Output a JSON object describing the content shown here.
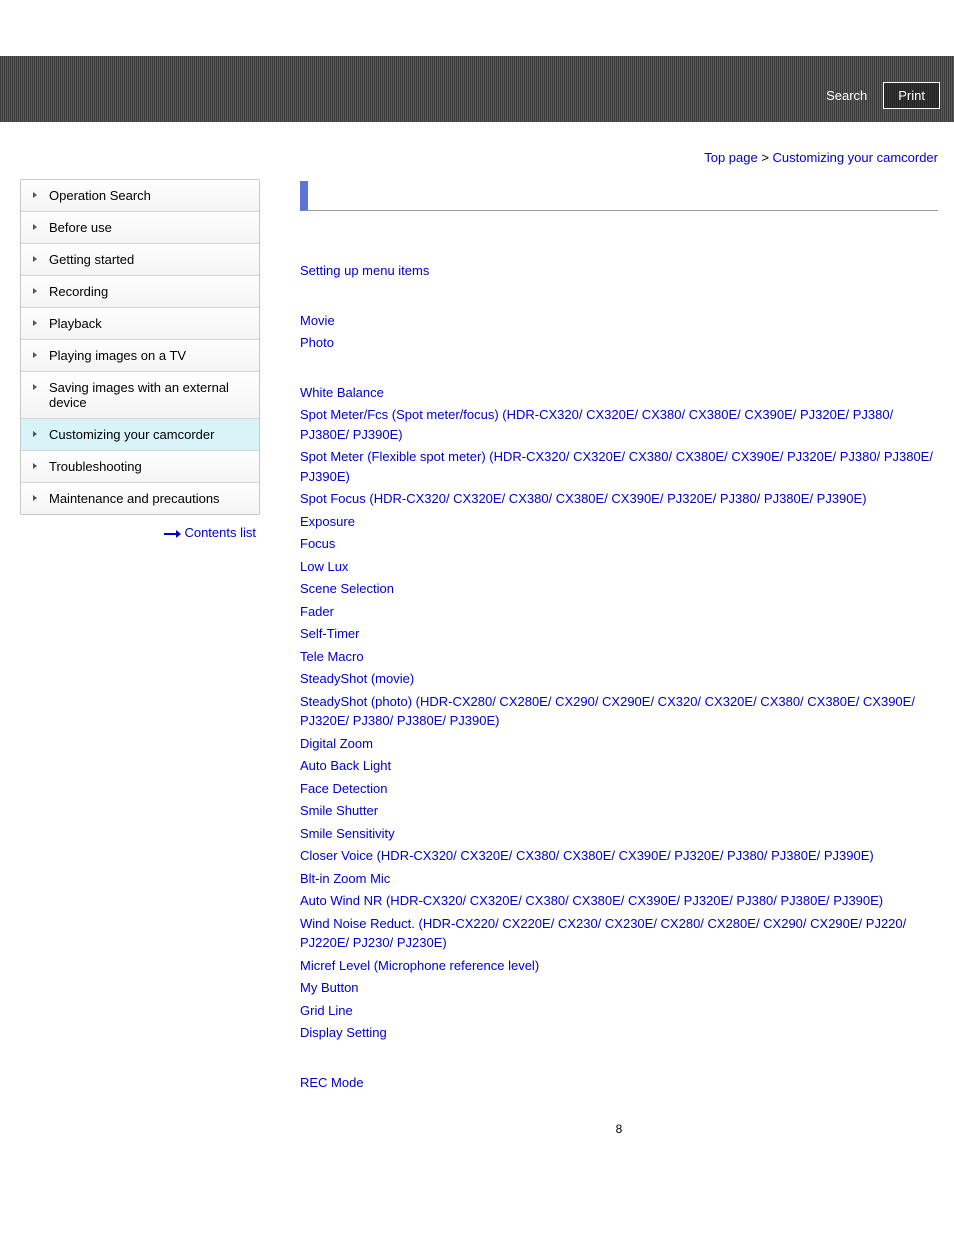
{
  "header": {
    "search": "Search",
    "print": "Print"
  },
  "breadcrumb": {
    "top": "Top page",
    "sep": " > ",
    "current": "Customizing your camcorder"
  },
  "sidebar": {
    "items": [
      {
        "label": "Operation Search",
        "active": false
      },
      {
        "label": "Before use",
        "active": false
      },
      {
        "label": "Getting started",
        "active": false
      },
      {
        "label": "Recording",
        "active": false
      },
      {
        "label": "Playback",
        "active": false
      },
      {
        "label": "Playing images on a TV",
        "active": false
      },
      {
        "label": "Saving images with an external device",
        "active": false
      },
      {
        "label": "Customizing your camcorder",
        "active": true
      },
      {
        "label": "Troubleshooting",
        "active": false
      },
      {
        "label": "Maintenance and precautions",
        "active": false
      }
    ],
    "contents_list": "Contents list"
  },
  "main": {
    "group1": [
      "Setting up menu items"
    ],
    "group2": [
      "Movie",
      "Photo"
    ],
    "group3": [
      "White Balance",
      "Spot Meter/Fcs (Spot meter/focus) (HDR-CX320/ CX320E/ CX380/ CX380E/ CX390E/ PJ320E/ PJ380/ PJ380E/ PJ390E)",
      "Spot Meter (Flexible spot meter) (HDR-CX320/ CX320E/ CX380/ CX380E/ CX390E/ PJ320E/ PJ380/ PJ380E/ PJ390E)",
      "Spot Focus (HDR-CX320/ CX320E/ CX380/ CX380E/ CX390E/ PJ320E/ PJ380/ PJ380E/ PJ390E)",
      "Exposure",
      "Focus",
      "Low Lux",
      "Scene Selection",
      "Fader",
      "Self-Timer",
      "Tele Macro",
      "SteadyShot (movie)",
      "SteadyShot (photo) (HDR-CX280/ CX280E/ CX290/ CX290E/ CX320/ CX320E/ CX380/ CX380E/ CX390E/ PJ320E/ PJ380/ PJ380E/ PJ390E)",
      "Digital Zoom",
      "Auto Back Light",
      "Face Detection",
      "Smile Shutter",
      "Smile Sensitivity",
      "Closer Voice (HDR-CX320/ CX320E/ CX380/ CX380E/ CX390E/ PJ320E/ PJ380/ PJ380E/ PJ390E)",
      "Blt-in Zoom Mic",
      "Auto Wind NR (HDR-CX320/ CX320E/ CX380/ CX380E/ CX390E/ PJ320E/ PJ380/ PJ380E/ PJ390E)",
      "Wind Noise Reduct. (HDR-CX220/ CX220E/ CX230/ CX230E/ CX280/ CX280E/ CX290/ CX290E/ PJ220/ PJ220E/ PJ230/ PJ230E)",
      "Micref Level (Microphone reference level)",
      "My Button",
      "Grid Line",
      "Display Setting"
    ],
    "group4": [
      "REC Mode"
    ]
  },
  "page_number": "8"
}
